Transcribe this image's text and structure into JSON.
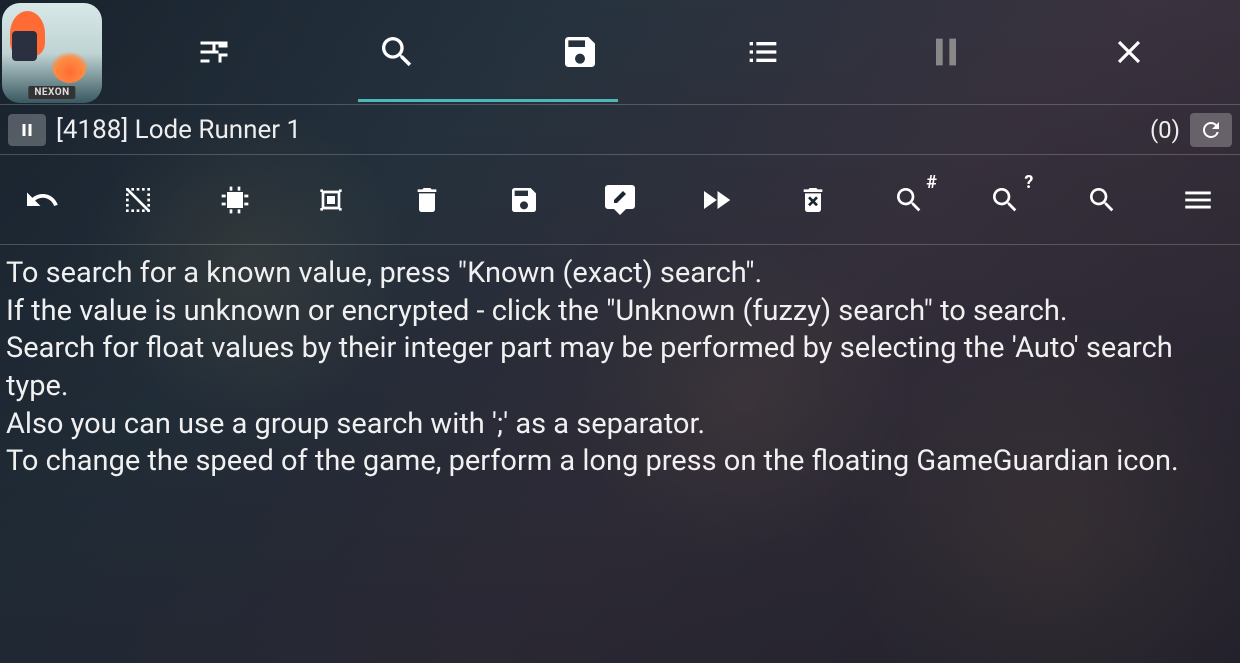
{
  "app_icon": {
    "brand": "NEXON"
  },
  "top_tabs": {
    "active_index": 1,
    "items": [
      {
        "name": "settings-icon"
      },
      {
        "name": "search-icon"
      },
      {
        "name": "save-icon"
      },
      {
        "name": "list-icon"
      },
      {
        "name": "pause-icon"
      },
      {
        "name": "close-icon"
      }
    ]
  },
  "process": {
    "label": "[4188] Lode Runner 1",
    "count": "(0)"
  },
  "toolbar": {
    "items": [
      {
        "name": "undo-icon"
      },
      {
        "name": "select-none-icon"
      },
      {
        "name": "memory-chip-icon"
      },
      {
        "name": "memory-chip-outline-icon"
      },
      {
        "name": "trash-icon"
      },
      {
        "name": "save-icon"
      },
      {
        "name": "edit-tag-icon"
      },
      {
        "name": "fast-forward-icon"
      },
      {
        "name": "trash-x-icon"
      },
      {
        "name": "search-number-icon",
        "sup": "#"
      },
      {
        "name": "search-unknown-icon",
        "sup": "?"
      },
      {
        "name": "search-icon"
      },
      {
        "name": "menu-icon"
      }
    ]
  },
  "help": {
    "lines": [
      "To search for a known value, press \"Known (exact) search\".",
      "If the value is unknown or encrypted - click the \"Unknown (fuzzy) search\" to search.",
      "Search for float values by their integer part may be performed by selecting the 'Auto' search type.",
      "Also you can use a group search with ';' as a separator.",
      "To change the speed of the game, perform a long press on the floating GameGuardian icon."
    ]
  }
}
